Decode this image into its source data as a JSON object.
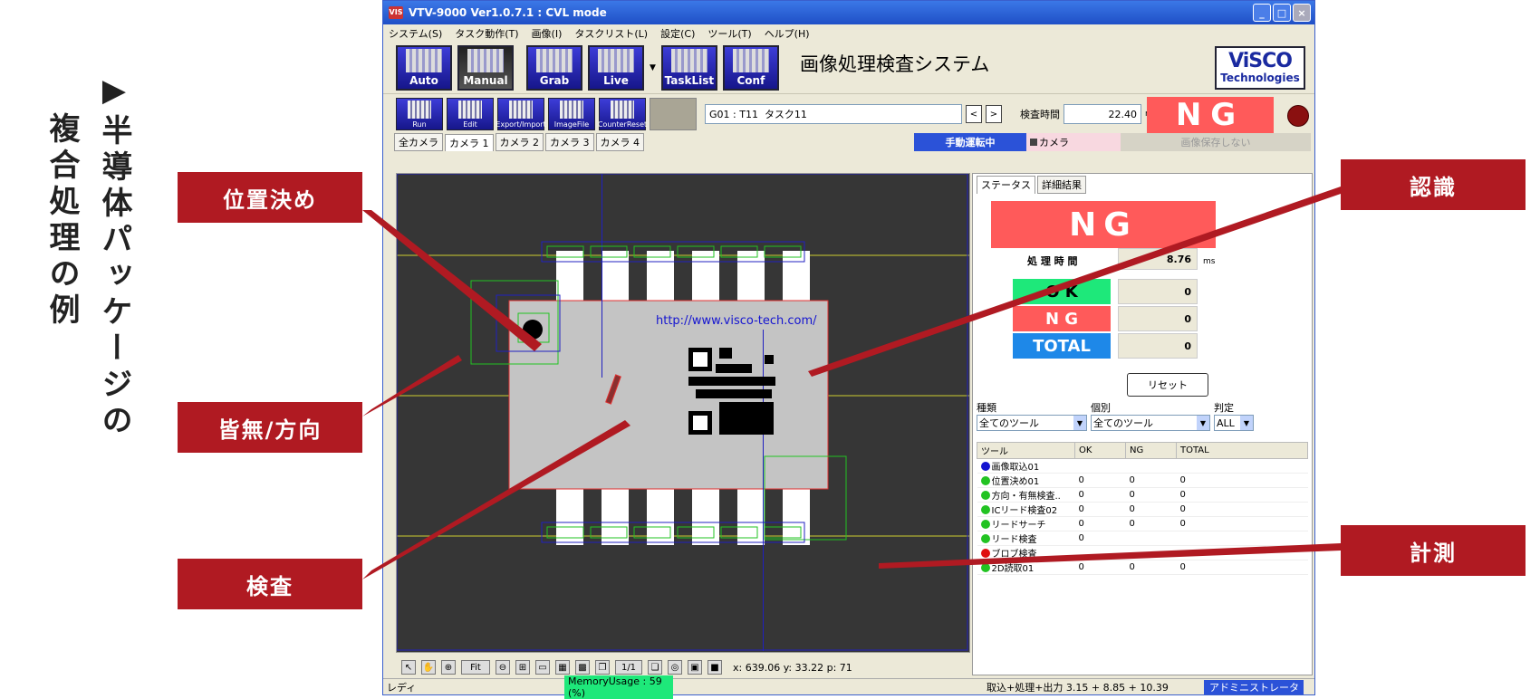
{
  "slide": {
    "title_vertical_1": "▶半導体パッケージの",
    "title_vertical_2": "複合処理の例",
    "callouts": {
      "position": "位置決め",
      "presence": "皆無/方向",
      "inspection": "検査",
      "recognition": "認識",
      "measurement": "計測"
    }
  },
  "window": {
    "title": "VTV-9000 Ver1.0.7.1 : CVL mode",
    "app_icon": "VIS",
    "controls": [
      "_",
      "□",
      "×"
    ]
  },
  "menu": [
    "システム(S)",
    "タスク動作(T)",
    "画像(I)",
    "タスクリスト(L)",
    "設定(C)",
    "ツール(T)",
    "ヘルプ(H)"
  ],
  "toolbar_main": [
    "Auto",
    "Manual",
    "Grab",
    "Live",
    "TaskList",
    "Conf"
  ],
  "system_name": "画像処理検査システム",
  "logo": {
    "line1": "ViSCO",
    "line2": "Technologies"
  },
  "toolbar_sub": [
    "Run",
    "Edit",
    "Export/Import",
    "ImageFile",
    "CounterReset"
  ],
  "task": {
    "id": "G01 : T11",
    "name": "タスク11",
    "prev": "<",
    "next": ">",
    "time_label": "検査時間",
    "time_value": "22.40",
    "time_unit": "ms",
    "result": "NG"
  },
  "camera_tabs": [
    "全カメラ",
    "カメラ 1",
    "カメラ 2",
    "カメラ 3",
    "カメラ 4"
  ],
  "mode_band": "手動運転中",
  "camera_label": "カメラ",
  "save_status": "画像保存しない",
  "image": {
    "url_text": "http://www.visco-tech.com/",
    "coords": "x: 639.06 y: 33.22 p: 71"
  },
  "view_tools": {
    "fit": "Fit",
    "page": "1/1"
  },
  "status_bar": {
    "ready": "レディ",
    "memory": "MemoryUsage : 59 (%)",
    "timing": "取込+処理+出力  3.15 + 8.85 + 10.39",
    "user": "アドミニストレータ"
  },
  "right_panel": {
    "tabs": [
      "ステータス",
      "詳細結果"
    ],
    "result": "NG",
    "proc_time_label": "処 理 時 間",
    "proc_time_value": "8.76",
    "proc_time_unit": "ms",
    "ok_label": "O K",
    "ng_label": "N G",
    "total_label": "TOTAL",
    "ok_count": "0",
    "ng_count": "0",
    "total_count": "0",
    "reset": "リセット",
    "filter_labels": [
      "種類",
      "個別",
      "判定"
    ],
    "filter_values": [
      "全てのツール",
      "全てのツール",
      "ALL"
    ],
    "table_headers": [
      "ツール",
      "OK",
      "NG",
      "TOTAL"
    ],
    "rows": [
      {
        "name": "画像取込01",
        "ok": "",
        "ng": "",
        "total": "",
        "mark": "#1414d0"
      },
      {
        "name": "位置決め01",
        "ok": "0",
        "ng": "0",
        "total": "0",
        "mark": "#22c322"
      },
      {
        "name": "方向・有無検査..",
        "ok": "0",
        "ng": "0",
        "total": "0",
        "mark": "#22c322"
      },
      {
        "name": "ICリード検査02",
        "ok": "0",
        "ng": "0",
        "total": "0",
        "mark": "#22c322"
      },
      {
        "name": "リードサーチ",
        "ok": "0",
        "ng": "0",
        "total": "0",
        "mark": "#22c322"
      },
      {
        "name": "リード検査",
        "ok": "0",
        "ng": "",
        "total": "",
        "mark": "#22c322"
      },
      {
        "name": "ブロブ検査",
        "ok": "",
        "ng": "",
        "total": "",
        "mark": "#e01010"
      },
      {
        "name": "2D読取01",
        "ok": "0",
        "ng": "0",
        "total": "0",
        "mark": "#22c322"
      }
    ]
  },
  "colors": {
    "ng": "#ff5a5a",
    "ok": "#1ee87a",
    "total": "#1e88e8",
    "manual": "#2b52d8"
  }
}
